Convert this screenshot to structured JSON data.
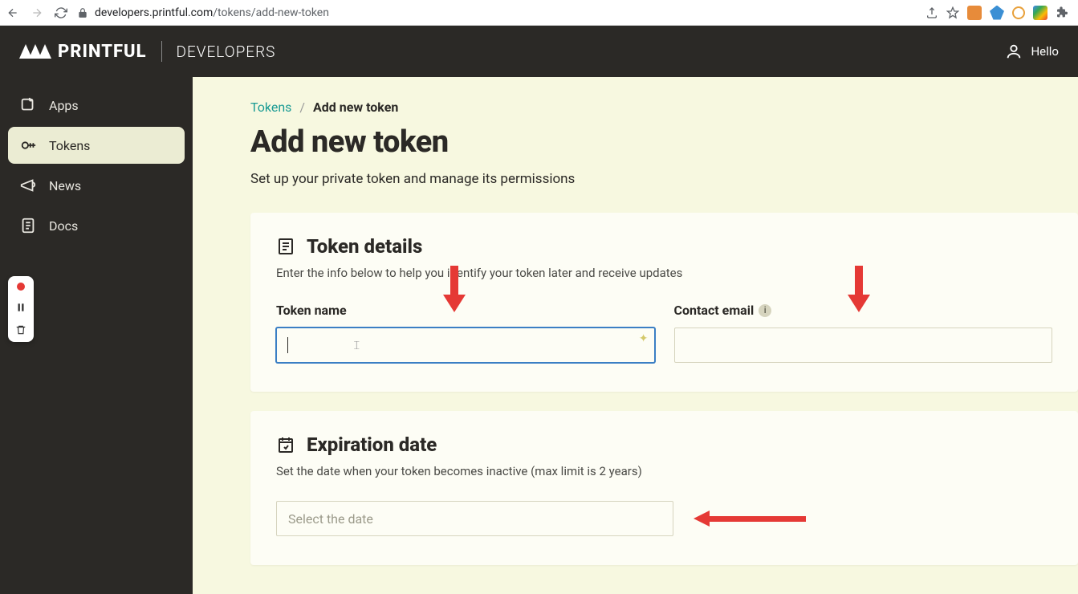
{
  "browser": {
    "url_host": "developers.printful.com",
    "url_path": "/tokens/add-new-token"
  },
  "header": {
    "brand": "PRINTFUL",
    "section": "DEVELOPERS",
    "greeting": "Hello"
  },
  "sidebar": {
    "items": [
      {
        "label": "Apps",
        "icon": "app"
      },
      {
        "label": "Tokens",
        "icon": "key"
      },
      {
        "label": "News",
        "icon": "mega"
      },
      {
        "label": "Docs",
        "icon": "doc"
      }
    ],
    "activeIndex": 1
  },
  "breadcrumb": {
    "parent": "Tokens",
    "current": "Add new token"
  },
  "page": {
    "title": "Add new token",
    "subtitle": "Set up your private token and manage its permissions"
  },
  "cards": {
    "details": {
      "title": "Token details",
      "subtitle": "Enter the info below to help you identify your token later and receive updates",
      "fields": {
        "name_label": "Token name",
        "name_value": "",
        "email_label": "Contact email",
        "email_value": ""
      }
    },
    "expiration": {
      "title": "Expiration date",
      "subtitle": "Set the date when your token becomes inactive (max limit is 2 years)",
      "placeholder": "Select the date"
    }
  }
}
